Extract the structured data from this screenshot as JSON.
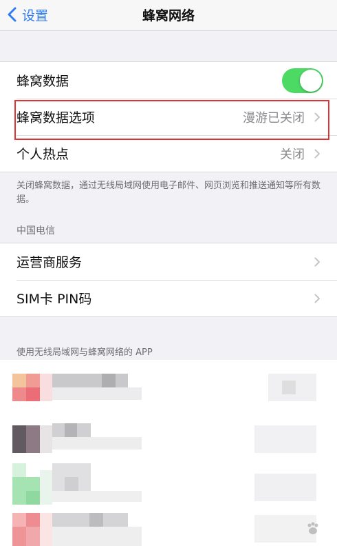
{
  "nav": {
    "back_label": "设置",
    "title": "蜂窝网络"
  },
  "group1": {
    "cellular_data": {
      "label": "蜂窝数据",
      "toggle_on": true
    },
    "cellular_options": {
      "label": "蜂窝数据选项",
      "value": "漫游已关闭"
    },
    "hotspot": {
      "label": "个人热点",
      "value": "关闭"
    }
  },
  "footnote": "关闭蜂窝数据，通过无线局域网使用电子邮件、网页浏览和推送通知等所有数据。",
  "carrier_section": {
    "header": "中国电信",
    "items": [
      {
        "label": "运营商服务"
      },
      {
        "label": "SIM卡 PIN码"
      }
    ]
  },
  "wlan_section_header": "使用无线局域网与蜂窝网络的 APP",
  "colors": {
    "accent": "#2f7cf6",
    "toggle_on": "#4cd964",
    "highlight": "#e03434"
  }
}
